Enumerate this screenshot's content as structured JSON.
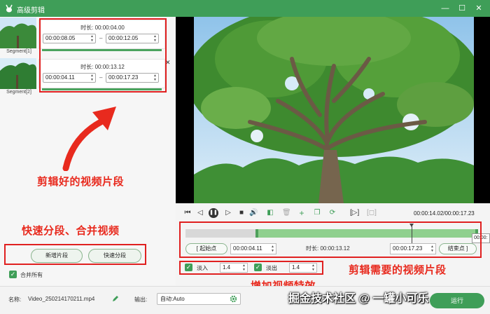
{
  "window": {
    "title": "高级剪辑",
    "minimize": "—",
    "maximize": "☐",
    "close": "✕"
  },
  "segments": [
    {
      "label": "Segment[1]",
      "duration": "时长: 00:00:04.00",
      "start": "00:00:08.05",
      "end": "00:00:12.05"
    },
    {
      "label": "Segment[2]",
      "duration": "时长: 00:00:13.12",
      "start": "00:00:04.11",
      "end": "00:00:17.23"
    }
  ],
  "segment_dash": "–",
  "segment_close": "✕",
  "left_buttons": {
    "add_segment": "新增片段",
    "quick_split": "快速分段"
  },
  "merge_all": "合并所有",
  "annotations": {
    "clipped_segments": "剪辑好的视频片段",
    "quick_split_merge": "快速分段、合并视频",
    "clip_needed": "剪辑需要的视频片段",
    "add_effects": "增加视频特效"
  },
  "player": {
    "timecode": "00:00:14.02/00:00:17.23",
    "icons": [
      "skip-back-icon",
      "step-back-icon",
      "pause-icon",
      "step-forward-icon",
      "stop-icon",
      "volume-icon",
      "split-icon",
      "delete-icon",
      "add-icon",
      "copy-icon",
      "refresh-icon",
      "mark-in-icon",
      "mark-out-icon"
    ]
  },
  "clip": {
    "start_label": "起始点",
    "start_value": "00:00:04.11",
    "duration_label": "时长: 00:00:13.12",
    "end_value": "00:00:17.23",
    "end_label": "结束点",
    "tooltip": "00:00:"
  },
  "effects": {
    "fade_in_label": "淡入",
    "fade_in_value": "1.4",
    "fade_out_label": "淡出",
    "fade_out_value": "1.4"
  },
  "bottom": {
    "name_label": "名称:",
    "name_value": "Video_250214170211.mp4",
    "output_label": "输出:",
    "output_value": "自动:Auto",
    "start_button": "运行"
  },
  "watermark": "掘金技术社区 @ 一罐小可乐",
  "colors": {
    "brand": "#3f9e58",
    "annotation": "#e82a1e",
    "selection": "#8fd08e"
  }
}
